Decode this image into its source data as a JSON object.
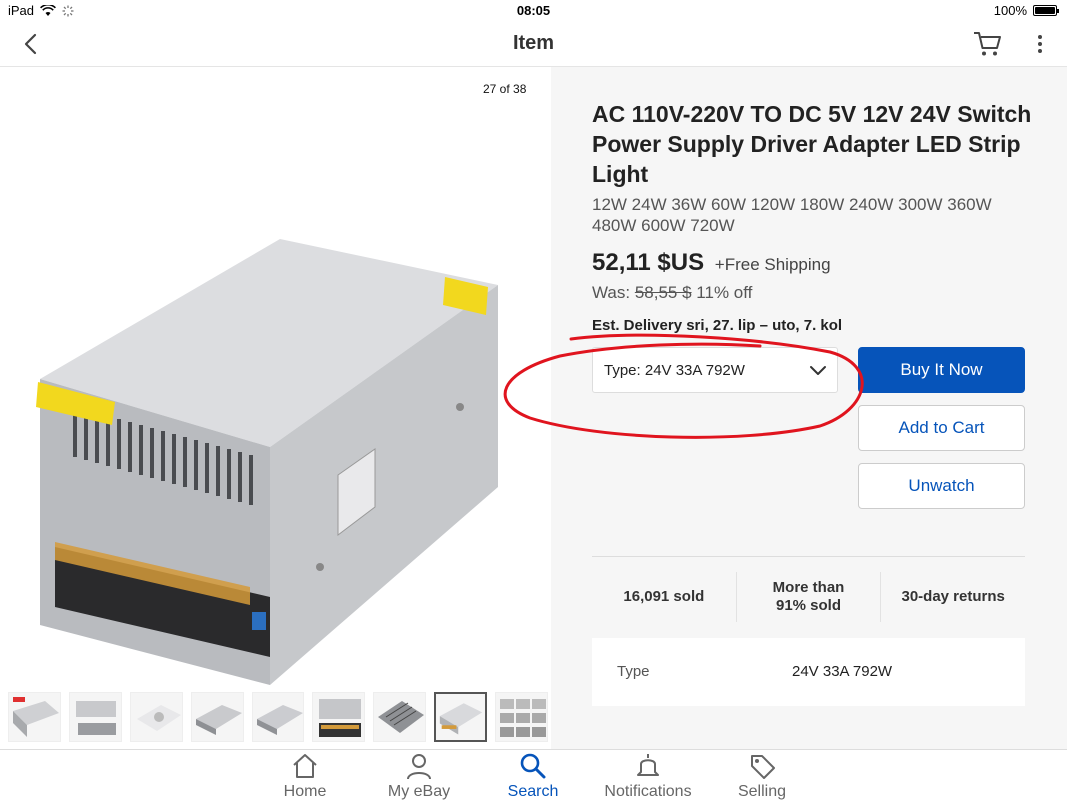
{
  "status_bar": {
    "device": "iPad",
    "time": "08:05",
    "battery": "100%"
  },
  "header": {
    "title": "Item"
  },
  "gallery": {
    "counter": "27 of 38",
    "thumb_count": 9,
    "active_thumb": 8
  },
  "product": {
    "title": "AC 110V-220V TO DC 5V 12V 24V Switch Power Supply Driver Adapter LED Strip Light",
    "subtitle": "12W 24W 36W 60W 120W 180W 240W 300W 360W 480W 600W 720W",
    "price": "52,11 $US",
    "shipping": "+Free Shipping",
    "was_label": "Was:",
    "was_price": "58,55 $",
    "discount": "11% off",
    "delivery": "Est. Delivery sri, 27. lip – uto, 7. kol"
  },
  "variation": {
    "selected": "Type: 24V 33A 792W"
  },
  "buttons": {
    "buy_now": "Buy It Now",
    "add_to_cart": "Add to Cart",
    "unwatch": "Unwatch"
  },
  "stats": {
    "sold": "16,091 sold",
    "percent_line1": "More than",
    "percent_line2": "91% sold",
    "returns": "30-day returns"
  },
  "spec": {
    "key": "Type",
    "value": "24V 33A 792W"
  },
  "tabs": [
    {
      "label": "Home",
      "icon": "home-icon"
    },
    {
      "label": "My eBay",
      "icon": "person-icon"
    },
    {
      "label": "Search",
      "icon": "search-icon"
    },
    {
      "label": "Notifications",
      "icon": "bell-icon"
    },
    {
      "label": "Selling",
      "icon": "tag-icon"
    }
  ],
  "colors": {
    "accent": "#0654ba",
    "annotation": "#e0141e",
    "panel_bg": "#f6f6f6"
  }
}
